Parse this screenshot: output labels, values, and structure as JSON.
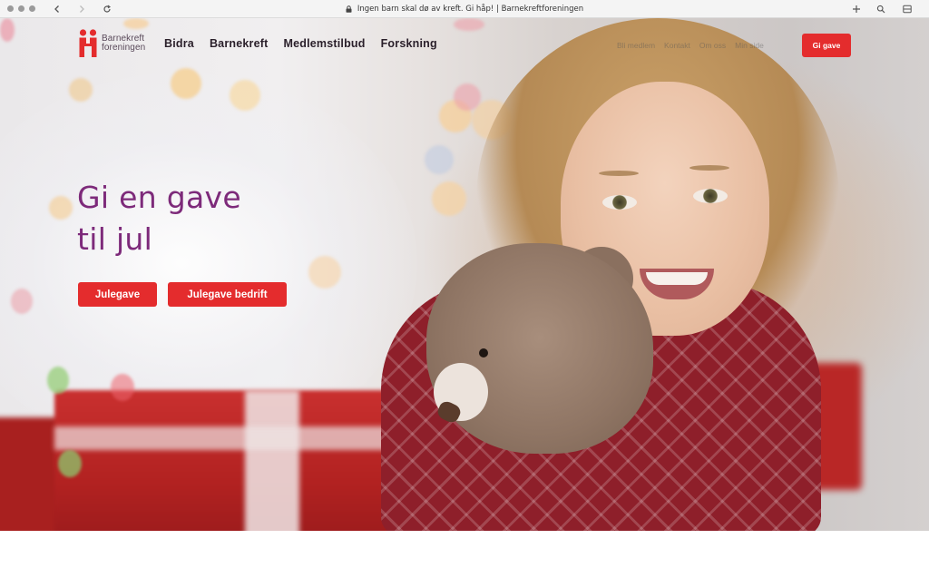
{
  "browser": {
    "url_title": "Ingen barn skal dø av kreft. Gi håp! | Barnekreftforeningen"
  },
  "site": {
    "logo_line1": "Barnekreft",
    "logo_line2": "foreningen",
    "nav": [
      "Bidra",
      "Barnekreft",
      "Medlemstilbud",
      "Forskning"
    ],
    "utility_nav": [
      "Bli medlem",
      "Kontakt",
      "Om oss",
      "Min side"
    ],
    "gift_button": "Gi gave",
    "brand_color": "#e42c2d",
    "headline_color": "#7d2a7a"
  },
  "hero": {
    "headline_line1": "Gi en gave",
    "headline_line2": "til jul",
    "cta_primary": "Julegave",
    "cta_secondary": "Julegave bedrift"
  }
}
